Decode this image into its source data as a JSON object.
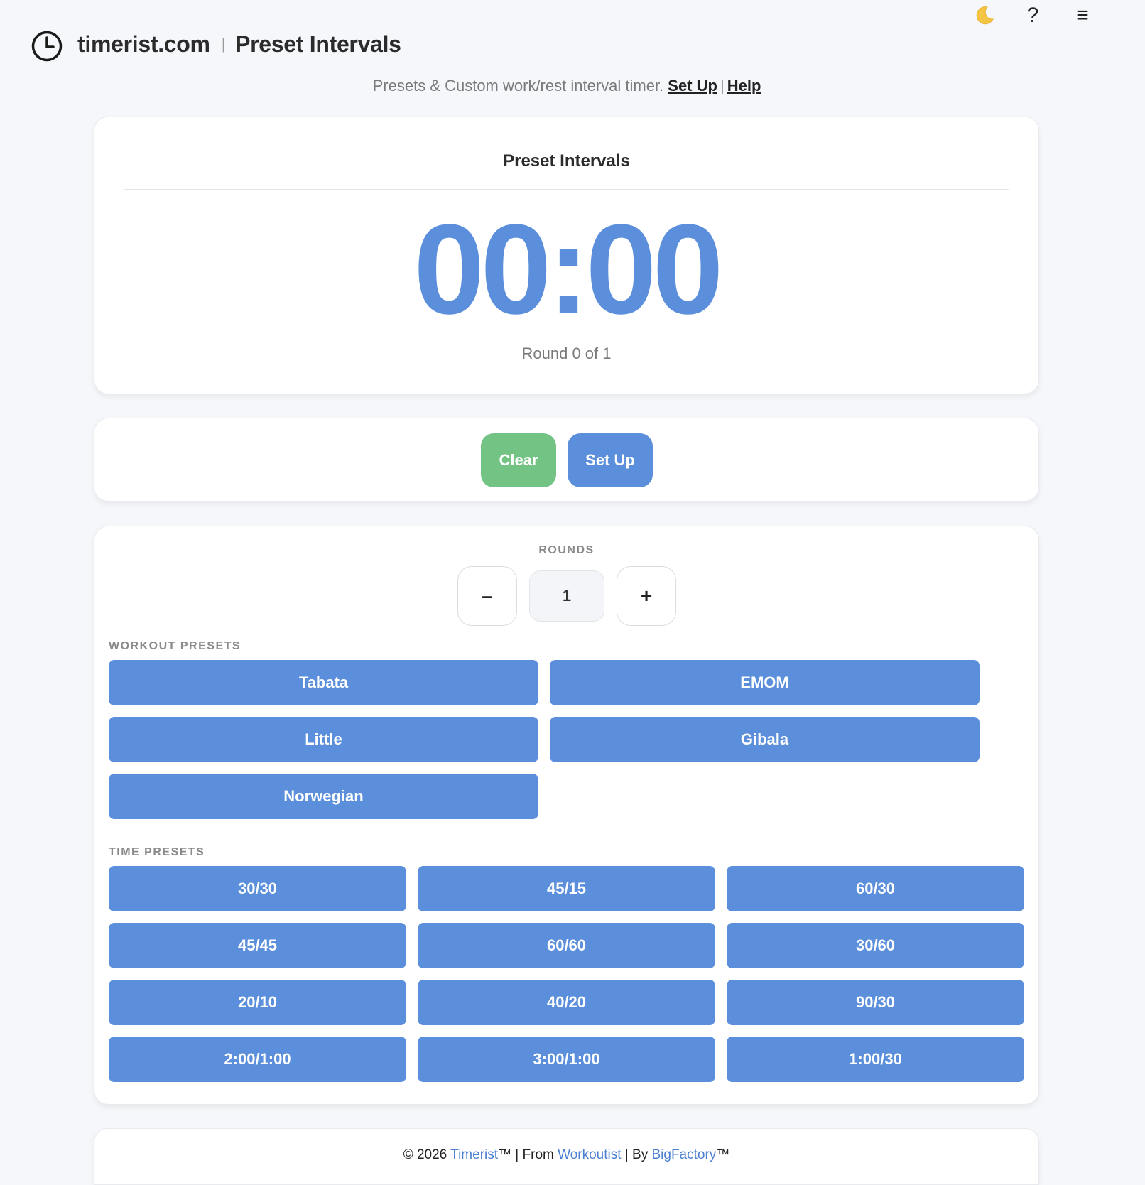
{
  "header": {
    "brand": "timerist.com",
    "separator": "|",
    "page_name": "Preset Intervals",
    "actions": {
      "dark_mode_icon": "moon-icon",
      "help_glyph": "?",
      "menu_glyph": "≡"
    }
  },
  "tagline": {
    "text": "Presets & Custom work/rest interval timer.",
    "setup_link": "Set Up",
    "divider": "|",
    "help_link": "Help"
  },
  "timer": {
    "title": "Preset Intervals",
    "display": "00:00",
    "round_status": "Round 0 of 1",
    "color": "#5b8fdb"
  },
  "controls": {
    "clear_label": "Clear",
    "setup_label": "Set Up",
    "clear_color": "#73c385",
    "setup_color": "#5b8fdb"
  },
  "rounds": {
    "label": "ROUNDS",
    "minus": "–",
    "value": "1",
    "plus": "+"
  },
  "workout_presets": {
    "label": "WORKOUT PRESETS",
    "items": [
      "Tabata",
      "EMOM",
      "Little",
      "Gibala",
      "Norwegian"
    ]
  },
  "time_presets": {
    "label": "TIME PRESETS",
    "items": [
      "30/30",
      "45/15",
      "60/30",
      "45/45",
      "60/60",
      "30/60",
      "20/10",
      "40/20",
      "90/30",
      "2:00/1:00",
      "3:00/1:00",
      "1:00/30"
    ]
  },
  "footer": {
    "prefix": "© 2026 ",
    "timerist_link": "Timerist",
    "mid1": "™ | From ",
    "workoutist_link": "Workoutist",
    "mid2": " | By ",
    "bigfactory_link": "BigFactory",
    "suffix": "™"
  },
  "colors": {
    "accent": "#5b8fdb",
    "success": "#73c385",
    "background": "#f5f7fa"
  }
}
